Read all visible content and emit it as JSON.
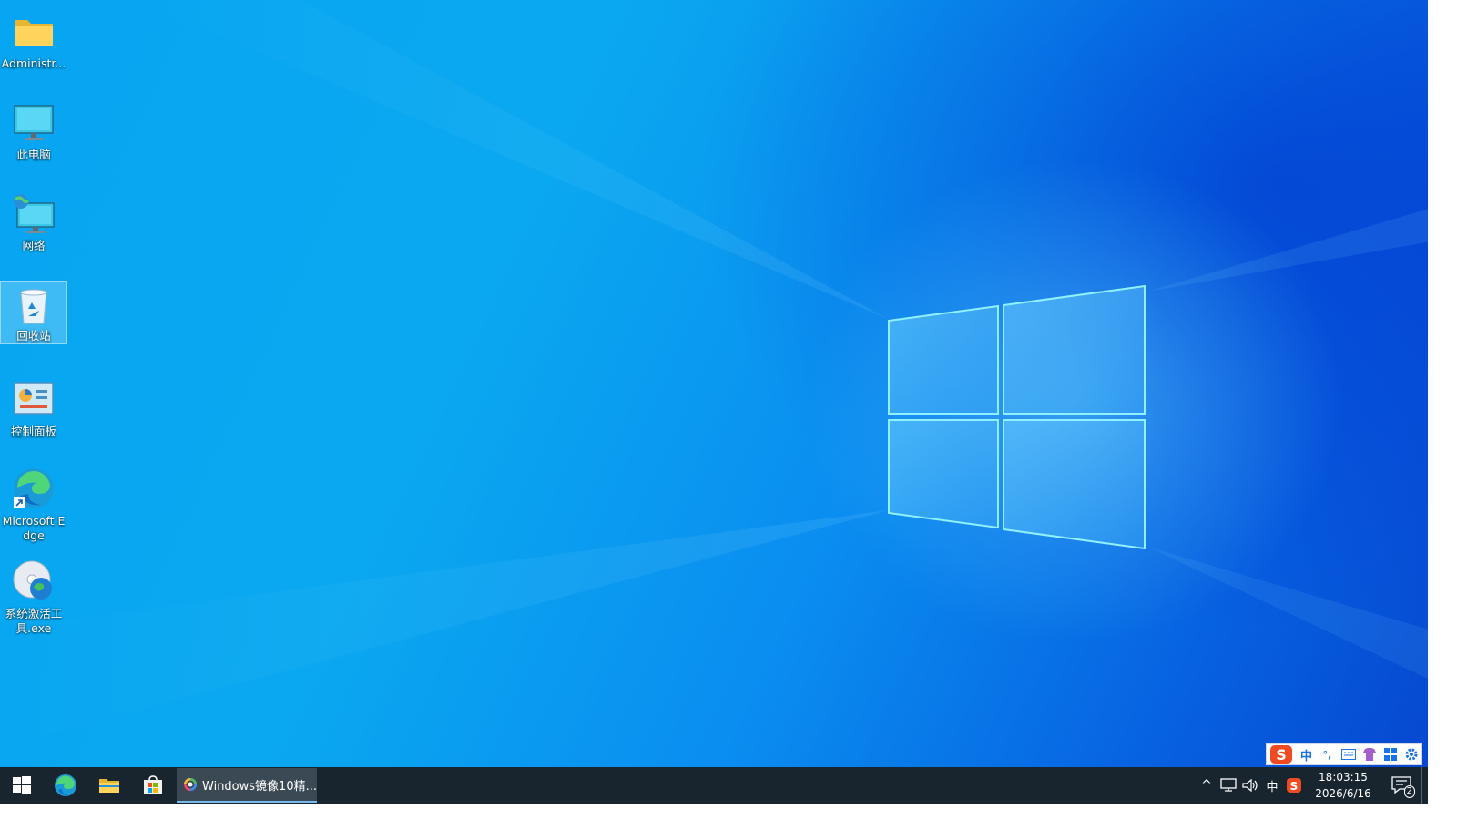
{
  "desktop": {
    "icons": [
      {
        "label": "Administr...",
        "icon": "folder-icon"
      },
      {
        "label": "此电脑",
        "icon": "monitor-icon"
      },
      {
        "label": "网络",
        "icon": "network-icon"
      },
      {
        "label": "回收站",
        "icon": "recycle-bin-icon"
      },
      {
        "label": "控制面板",
        "icon": "control-panel-icon"
      },
      {
        "label": "Microsoft Edge",
        "icon": "edge-icon"
      },
      {
        "label": "系统激活工具.exe",
        "icon": "activation-tool-icon"
      }
    ],
    "selected_icon": "回收站"
  },
  "ime_toolbar": {
    "items": [
      "sogou-logo-icon",
      "中",
      "°,",
      "keyboard-icon",
      "skin-icon",
      "apps-icon",
      "settings-icon"
    ],
    "mode_label": "中",
    "punct_label": "°,"
  },
  "taskbar": {
    "pinned": [
      "start-icon",
      "edge-icon",
      "file-explorer-icon",
      "store-icon"
    ],
    "open_window": {
      "label": "Windows镜像10精...",
      "icon": "app-color-ring-icon"
    },
    "tray": {
      "overflow": "^",
      "ime_label": "中",
      "time": "18:03:15",
      "date": "2026/6/16",
      "notification_count": "2"
    }
  },
  "colors": {
    "taskbar": "#18252f",
    "desktop_primary": "#0aa8f0",
    "desktop_deep": "#0648d0",
    "accent": "#76b9ed"
  }
}
